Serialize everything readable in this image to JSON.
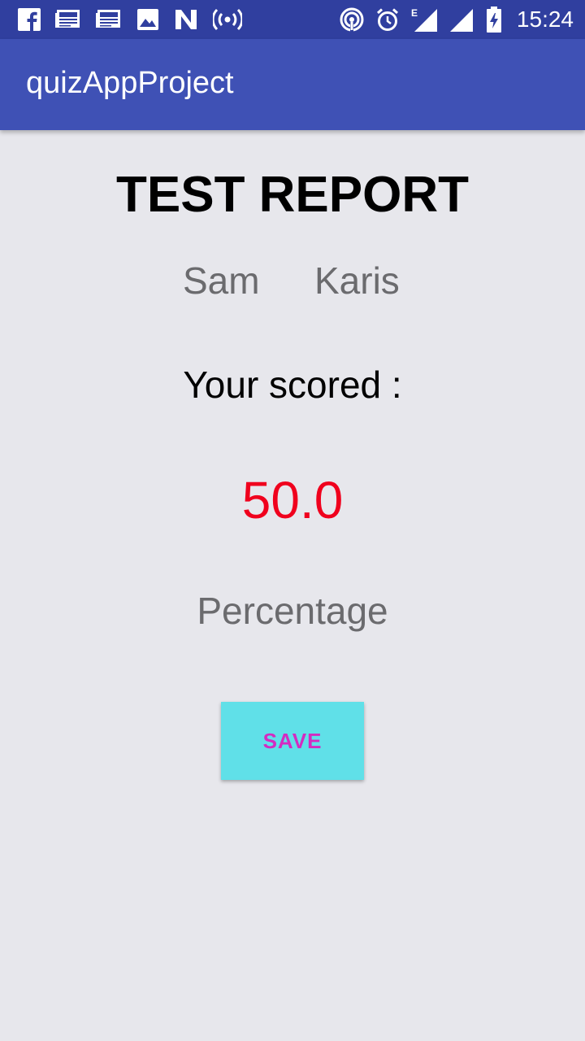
{
  "status_bar": {
    "time": "15:24",
    "network_type": "E",
    "left_icons": [
      "facebook-icon",
      "news-icon",
      "news-icon",
      "image-icon",
      "n-app-icon",
      "hotspot-icon"
    ],
    "right_icons": [
      "hotspot-tethering-icon",
      "alarm-icon",
      "signal-icon",
      "signal-icon",
      "battery-charging-icon"
    ]
  },
  "app_bar": {
    "title": "quizAppProject"
  },
  "report": {
    "title": "TEST REPORT",
    "first_name": "Sam",
    "last_name": "Karis",
    "scored_label": "Your scored :",
    "score": "50.0",
    "percentage_label": "Percentage",
    "save_label": "SAVE"
  },
  "colors": {
    "status_bar": "#303F9F",
    "app_bar": "#3F51B5",
    "background": "#E7E7EC",
    "score": "#F0001D",
    "button_bg": "#60E0E8",
    "button_text": "#D42BC1",
    "secondary_text": "#6B6B6E"
  }
}
